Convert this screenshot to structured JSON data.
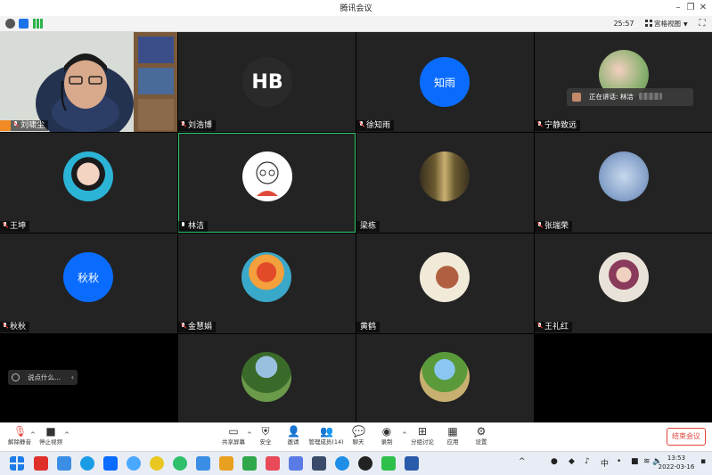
{
  "window": {
    "title": "腾讯会议"
  },
  "infobar": {
    "timer": "25:57",
    "view_label": "宫格视图"
  },
  "speaking": {
    "prefix": "正在讲话:",
    "name": "林洁"
  },
  "tiles": [
    {
      "name": "刘啸尘",
      "avatar_text": ""
    },
    {
      "name": "刘浩博",
      "avatar_text": "HB"
    },
    {
      "name": "徐知雨",
      "avatar_text": "知雨"
    },
    {
      "name": "宁静致远",
      "avatar_text": ""
    },
    {
      "name": "王坤",
      "avatar_text": ""
    },
    {
      "name": "林洁",
      "avatar_text": ""
    },
    {
      "name": "梁栋",
      "avatar_text": ""
    },
    {
      "name": "张瑞荣",
      "avatar_text": ""
    },
    {
      "name": "秋秋",
      "avatar_text": "秋秋"
    },
    {
      "name": "金慧娟",
      "avatar_text": ""
    },
    {
      "name": "黄鹤",
      "avatar_text": ""
    },
    {
      "name": "王礼红",
      "avatar_text": ""
    }
  ],
  "chat": {
    "placeholder": "说点什么..."
  },
  "toolbar": {
    "unmute": "解除静音",
    "stop_video": "停止视频",
    "share": "共享屏幕",
    "security": "安全",
    "invite": "邀请",
    "members": "管理成员(14)",
    "chat": "聊天",
    "record": "录制",
    "breakout": "分组讨论",
    "apps": "应用",
    "settings": "设置",
    "end": "结束会议"
  },
  "taskbar": {
    "ime": "中",
    "time": "13:53",
    "date": "2022-03-16"
  }
}
